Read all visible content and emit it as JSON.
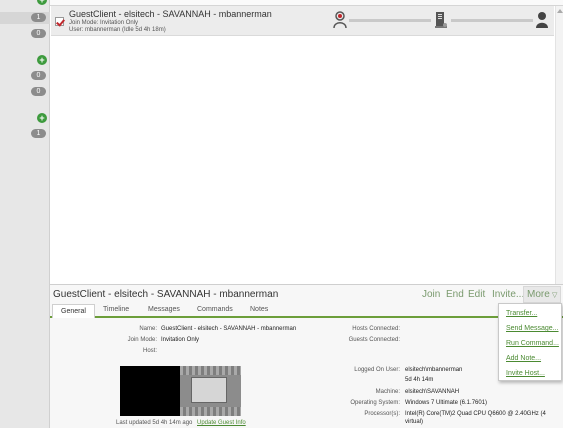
{
  "sidebar": {
    "badges": [
      "1",
      "0",
      "0",
      "0",
      "1"
    ]
  },
  "session": {
    "title": "GuestClient - elsitech - SAVANNAH - mbannerman",
    "join_mode": "Join Mode: Invitation Only",
    "user": "User: mbannerman (Idle 5d 4h 18m)"
  },
  "panel": {
    "title": "GuestClient - elsitech - SAVANNAH - mbannerman",
    "actions": {
      "join": "Join",
      "end": "End",
      "edit": "Edit",
      "invite": "Invite...",
      "more": "More"
    },
    "tabs": [
      "General",
      "Timeline",
      "Messages",
      "Commands",
      "Notes"
    ],
    "general": {
      "name_label": "Name:",
      "name_value": "GuestClient - elsitech - SAVANNAH - mbannerman",
      "join_mode_label": "Join Mode:",
      "join_mode_value": "Invitation Only",
      "host_label": "Host:",
      "hosts_connected_label": "Hosts Connected:",
      "guests_connected_label": "Guests Connected:",
      "logged_on_user_label": "Logged On User:",
      "logged_on_user_value": "elsitech\\mbannerman",
      "idle_value": "5d 4h 14m",
      "machine_label": "Machine:",
      "machine_value": "elsitech\\SAVANNAH",
      "os_label": "Operating System:",
      "os_value": "Windows 7 Ultimate (6.1.7601)",
      "processor_label": "Processor(s):",
      "processor_value_1": "Intel(R) Core(TM)2 Quad CPU Q6600 @ 2.40GHz (4",
      "processor_value_2": "virtual)",
      "last_updated": "Last updated 5d 4h 14m ago",
      "update_link": "Update Guest Info"
    }
  },
  "more_menu": {
    "items": [
      "Transfer...",
      "Send Message...",
      "Run Command...",
      "Add Note...",
      "Invite Host..."
    ]
  }
}
